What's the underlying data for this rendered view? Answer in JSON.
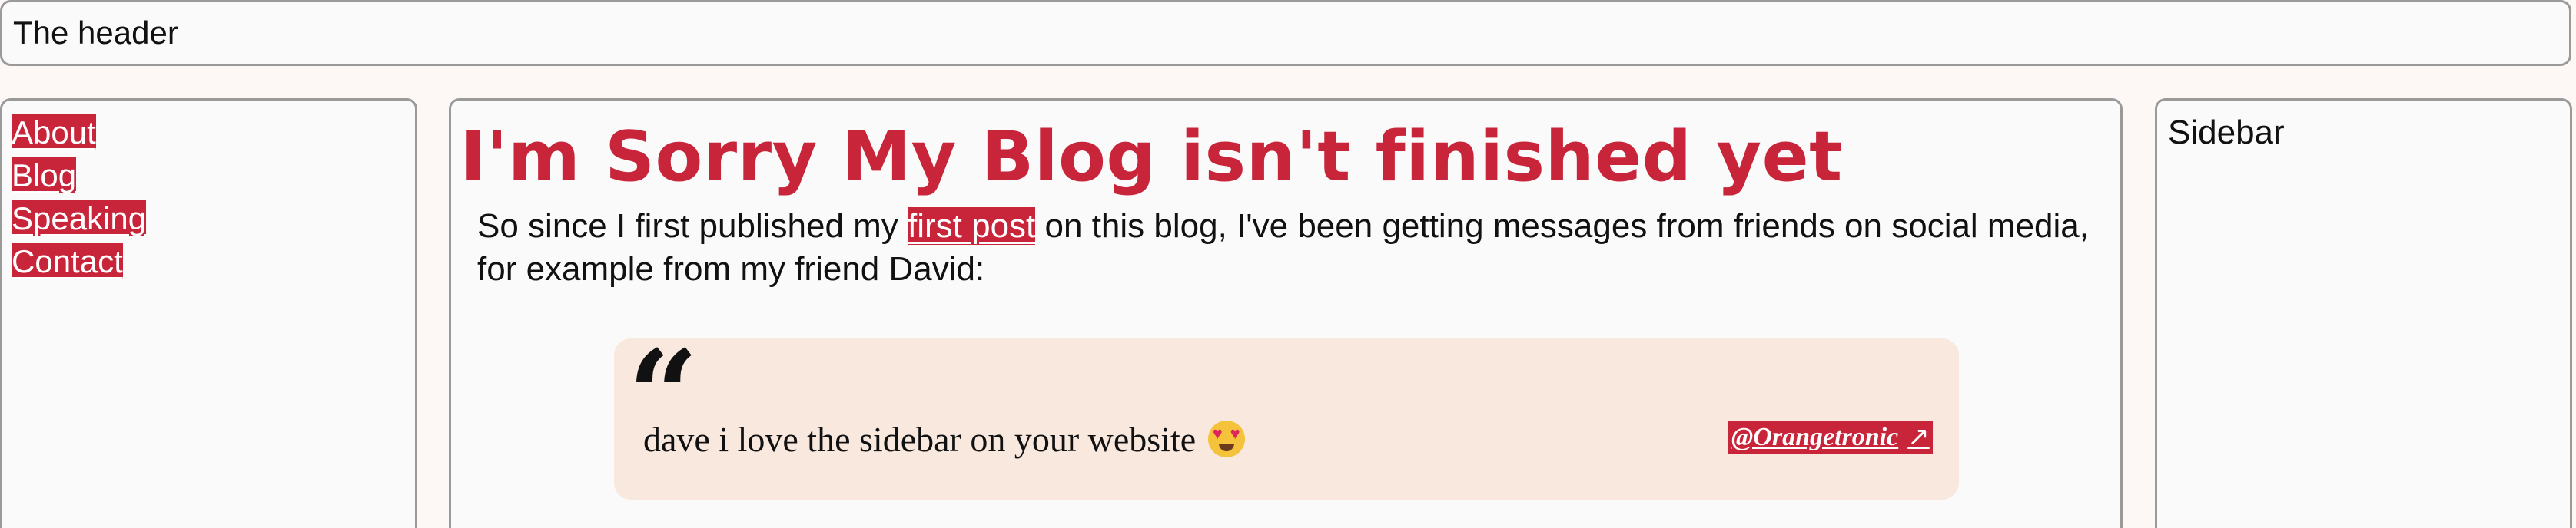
{
  "header": {
    "title": "The header"
  },
  "nav": {
    "items": [
      {
        "label": "About"
      },
      {
        "label": "Blog"
      },
      {
        "label": "Speaking"
      },
      {
        "label": "Contact"
      }
    ]
  },
  "main": {
    "title": "I'm Sorry My Blog isn't finished yet",
    "intro_before": "So since I first published my ",
    "intro_link": "first post",
    "intro_after": " on this blog, I've been getting messages from friends on social media, for example from my friend David:",
    "quote": {
      "mark": "“",
      "text": "dave i love the sidebar on your website",
      "emoji": "smiling-face-with-heart-eyes",
      "handle": "@Orangetronic",
      "handle_icon": "external-link-icon"
    }
  },
  "sidebar": {
    "title": "Sidebar"
  },
  "colors": {
    "accent": "#c8243a",
    "quote_bg": "#f8e8de",
    "page_bg": "#fdf8f6",
    "panel_bg": "#fafafa",
    "border": "#9a9a9a"
  }
}
